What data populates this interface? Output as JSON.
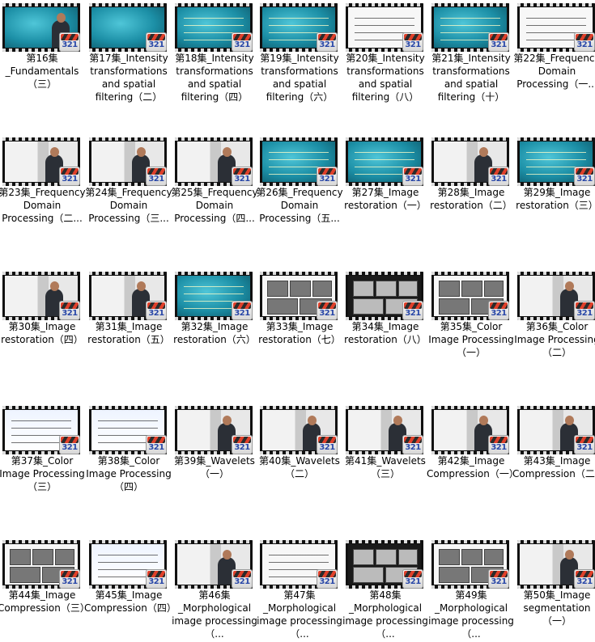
{
  "items": [
    {
      "title": "第16集_Fundamentals（三）",
      "thumb": "teal-person",
      "badge": "321"
    },
    {
      "title": "第17集_Intensity transformations and spatial filtering（二）",
      "thumb": "teal",
      "badge": "321"
    },
    {
      "title": "第18集_Intensity transformations and spatial filtering（四）",
      "thumb": "teal-text",
      "badge": "321"
    },
    {
      "title": "第19集_Intensity transformations and spatial filtering（六）",
      "thumb": "teal-text",
      "badge": "321"
    },
    {
      "title": "第20集_Intensity transformations and spatial filtering（八）",
      "thumb": "doc",
      "badge": "321"
    },
    {
      "title": "第21集_Intensity transformations and spatial filtering（十）",
      "thumb": "teal-text",
      "badge": "321"
    },
    {
      "title": "第22集_Frequency Domain Processing（一...",
      "thumb": "doc",
      "badge": "321"
    },
    {
      "title": "第23集_Frequency Domain Processing（二...",
      "thumb": "room-person",
      "badge": "321"
    },
    {
      "title": "第24集_Frequency Domain Processing（三...",
      "thumb": "room-person",
      "badge": "321"
    },
    {
      "title": "第25集_Frequency Domain Processing（四...",
      "thumb": "room-person",
      "badge": "321"
    },
    {
      "title": "第26集_Frequency Domain Processing（五...",
      "thumb": "teal-text",
      "badge": "321"
    },
    {
      "title": "第27集_Image restoration（一）",
      "thumb": "teal-text",
      "badge": "321"
    },
    {
      "title": "第28集_Image restoration（二）",
      "thumb": "room-person",
      "badge": "321"
    },
    {
      "title": "第29集_Image restoration（三）",
      "thumb": "teal-text",
      "badge": "321"
    },
    {
      "title": "第30集_Image restoration（四）",
      "thumb": "room-person",
      "badge": "321"
    },
    {
      "title": "第31集_Image restoration（五）",
      "thumb": "room-person",
      "badge": "321"
    },
    {
      "title": "第32集_Image restoration（六）",
      "thumb": "teal-text",
      "badge": "321"
    },
    {
      "title": "第33集_Image restoration（七）",
      "thumb": "doc-panels",
      "badge": "321"
    },
    {
      "title": "第34集_Image restoration（八）",
      "thumb": "dark-panels",
      "badge": "321"
    },
    {
      "title": "第35集_Color Image Processing（一）",
      "thumb": "doc-panels",
      "badge": "321"
    },
    {
      "title": "第36集_Color Image Processing（二）",
      "thumb": "room-person",
      "badge": "321"
    },
    {
      "title": "第37集_Color Image Processing（三）",
      "thumb": "paper",
      "badge": "321"
    },
    {
      "title": "第38集_Color Image Processing（四）",
      "thumb": "paper",
      "badge": "321"
    },
    {
      "title": "第39集_Wavelets（一）",
      "thumb": "room-person",
      "badge": "321"
    },
    {
      "title": "第40集_Wavelets（二）",
      "thumb": "room-person",
      "badge": "321"
    },
    {
      "title": "第41集_Wavelets（三）",
      "thumb": "room-person",
      "badge": "321"
    },
    {
      "title": "第42集_Image Compression（一）",
      "thumb": "room-person",
      "badge": "321"
    },
    {
      "title": "第43集_Image Compression（二）",
      "thumb": "room-person",
      "badge": "321"
    },
    {
      "title": "第44集_Image Compression（三）",
      "thumb": "doc-panels",
      "badge": "321"
    },
    {
      "title": "第45集_Image Compression（四）",
      "thumb": "paper",
      "badge": "321"
    },
    {
      "title": "第46集_Morphological image processing（...",
      "thumb": "room-person",
      "badge": "321"
    },
    {
      "title": "第47集_Morphological image processing（...",
      "thumb": "doc",
      "badge": "321"
    },
    {
      "title": "第48集_Morphological image processing（...",
      "thumb": "dark-panels",
      "badge": "321"
    },
    {
      "title": "第49集_Morphological image processing（...",
      "thumb": "doc-panels",
      "badge": "321"
    },
    {
      "title": "第50集_Image segmentation（一）",
      "thumb": "room-person",
      "badge": "321"
    }
  ]
}
